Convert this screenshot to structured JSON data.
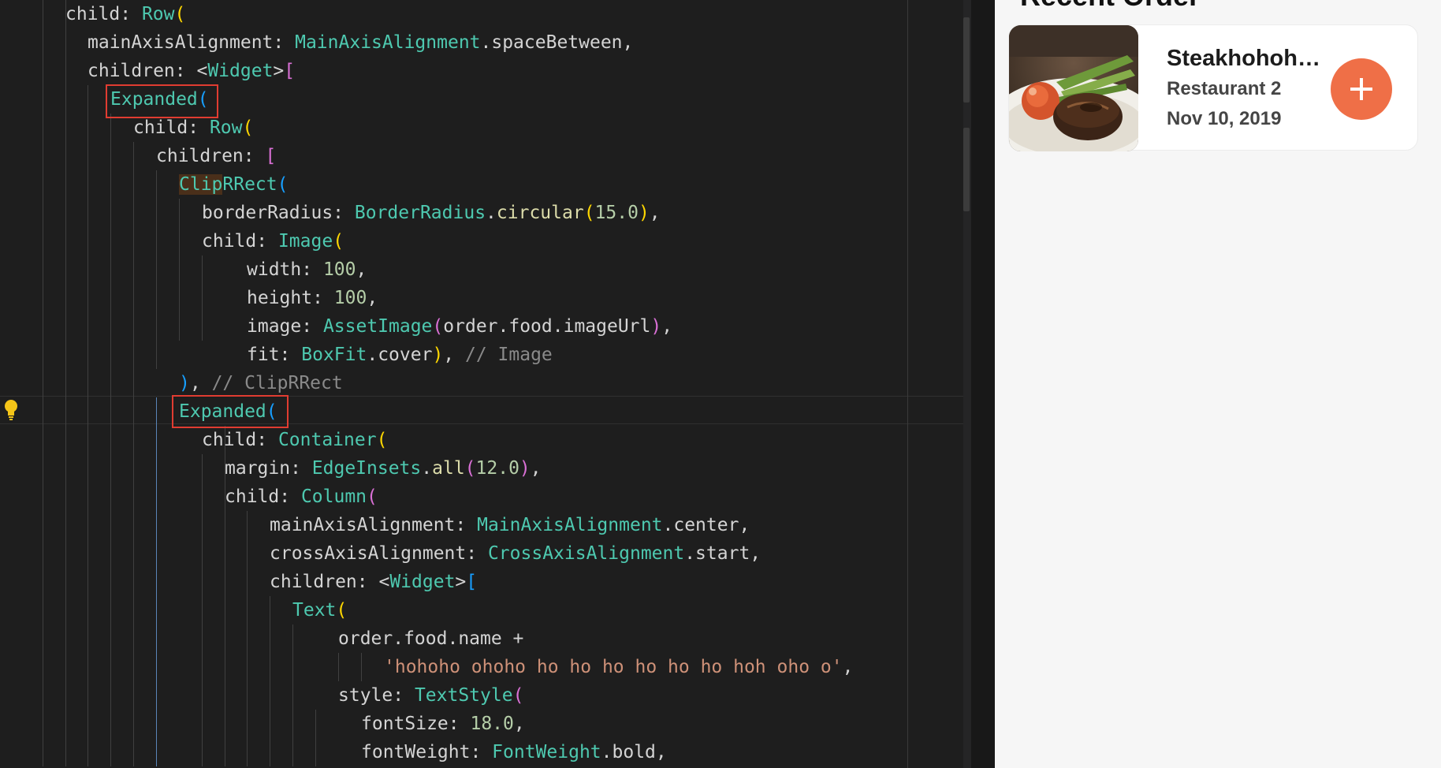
{
  "editor": {
    "lines": [
      [
        {
          "t": "child: ",
          "c": "kw"
        },
        {
          "t": "Row",
          "c": "cls"
        },
        {
          "t": "(",
          "c": "p1"
        }
      ],
      [
        {
          "t": "mainAxisAlignment: ",
          "c": "kw"
        },
        {
          "t": "MainAxisAlignment",
          "c": "cls"
        },
        {
          "t": ".spaceBetween,",
          "c": "kw"
        }
      ],
      [
        {
          "t": "children: <",
          "c": "kw"
        },
        {
          "t": "Widget",
          "c": "cls"
        },
        {
          "t": ">",
          "c": "kw"
        },
        {
          "t": "[",
          "c": "p2"
        }
      ],
      [
        {
          "t": "Expanded",
          "c": "cls"
        },
        {
          "t": "(",
          "c": "p3"
        }
      ],
      [
        {
          "t": "child: ",
          "c": "kw"
        },
        {
          "t": "Row",
          "c": "cls"
        },
        {
          "t": "(",
          "c": "p1"
        }
      ],
      [
        {
          "t": "children: ",
          "c": "kw"
        },
        {
          "t": "[",
          "c": "p2"
        }
      ],
      [
        {
          "t": "Clip",
          "c": "cls",
          "hl": true
        },
        {
          "t": "RRect",
          "c": "cls"
        },
        {
          "t": "(",
          "c": "p3"
        }
      ],
      [
        {
          "t": "borderRadius: ",
          "c": "kw"
        },
        {
          "t": "BorderRadius",
          "c": "cls"
        },
        {
          "t": ".",
          "c": "kw"
        },
        {
          "t": "circular",
          "c": "fn"
        },
        {
          "t": "(",
          "c": "p1"
        },
        {
          "t": "15.0",
          "c": "num"
        },
        {
          "t": ")",
          "c": "p1"
        },
        {
          "t": ",",
          "c": "kw"
        }
      ],
      [
        {
          "t": "child: ",
          "c": "kw"
        },
        {
          "t": "Image",
          "c": "cls"
        },
        {
          "t": "(",
          "c": "p1"
        }
      ],
      [
        {
          "t": "width: ",
          "c": "kw"
        },
        {
          "t": "100",
          "c": "num"
        },
        {
          "t": ",",
          "c": "kw"
        }
      ],
      [
        {
          "t": "height: ",
          "c": "kw"
        },
        {
          "t": "100",
          "c": "num"
        },
        {
          "t": ",",
          "c": "kw"
        }
      ],
      [
        {
          "t": "image: ",
          "c": "kw"
        },
        {
          "t": "AssetImage",
          "c": "cls"
        },
        {
          "t": "(",
          "c": "p2"
        },
        {
          "t": "order.food.imageUrl",
          "c": "kw"
        },
        {
          "t": ")",
          "c": "p2"
        },
        {
          "t": ",",
          "c": "kw"
        }
      ],
      [
        {
          "t": "fit: ",
          "c": "kw"
        },
        {
          "t": "BoxFit",
          "c": "cls"
        },
        {
          "t": ".cover",
          "c": "kw"
        },
        {
          "t": ")",
          "c": "p1"
        },
        {
          "t": ", ",
          "c": "kw"
        },
        {
          "t": "// Image",
          "c": "cmt"
        }
      ],
      [
        {
          "t": ")",
          "c": "p3"
        },
        {
          "t": ", ",
          "c": "kw"
        },
        {
          "t": "// ClipRRect",
          "c": "cmt"
        }
      ],
      [
        {
          "t": "Expanded",
          "c": "cls"
        },
        {
          "t": "(",
          "c": "p3"
        }
      ],
      [
        {
          "t": "child: ",
          "c": "kw"
        },
        {
          "t": "Container",
          "c": "cls"
        },
        {
          "t": "(",
          "c": "p1"
        }
      ],
      [
        {
          "t": "margin: ",
          "c": "kw"
        },
        {
          "t": "EdgeInsets",
          "c": "cls"
        },
        {
          "t": ".",
          "c": "kw"
        },
        {
          "t": "all",
          "c": "fn"
        },
        {
          "t": "(",
          "c": "p2"
        },
        {
          "t": "12.0",
          "c": "num"
        },
        {
          "t": ")",
          "c": "p2"
        },
        {
          "t": ",",
          "c": "kw"
        }
      ],
      [
        {
          "t": "child: ",
          "c": "kw"
        },
        {
          "t": "Column",
          "c": "cls"
        },
        {
          "t": "(",
          "c": "p2"
        }
      ],
      [
        {
          "t": "mainAxisAlignment: ",
          "c": "kw"
        },
        {
          "t": "MainAxisAlignment",
          "c": "cls"
        },
        {
          "t": ".center,",
          "c": "kw"
        }
      ],
      [
        {
          "t": "crossAxisAlignment: ",
          "c": "kw"
        },
        {
          "t": "CrossAxisAlignment",
          "c": "cls"
        },
        {
          "t": ".start,",
          "c": "kw"
        }
      ],
      [
        {
          "t": "children: <",
          "c": "kw"
        },
        {
          "t": "Widget",
          "c": "cls"
        },
        {
          "t": ">",
          "c": "kw"
        },
        {
          "t": "[",
          "c": "p3"
        }
      ],
      [
        {
          "t": "Text",
          "c": "cls"
        },
        {
          "t": "(",
          "c": "p1"
        }
      ],
      [
        {
          "t": "order.food.name +",
          "c": "kw"
        }
      ],
      [
        {
          "t": "'hohoho ohoho ho ho ho ho ho ho hoh oho o'",
          "c": "str"
        },
        {
          "t": ",",
          "c": "kw"
        }
      ],
      [
        {
          "t": "style: ",
          "c": "kw"
        },
        {
          "t": "TextStyle",
          "c": "cls"
        },
        {
          "t": "(",
          "c": "p2"
        }
      ],
      [
        {
          "t": "fontSize: ",
          "c": "kw"
        },
        {
          "t": "18.0",
          "c": "num"
        },
        {
          "t": ",",
          "c": "kw"
        }
      ],
      [
        {
          "t": "fontWeight: ",
          "c": "kw"
        },
        {
          "t": "FontWeight",
          "c": "cls"
        },
        {
          "t": ".bold,",
          "c": "kw"
        }
      ]
    ]
  },
  "preview": {
    "section_title": "Recent Order",
    "order": {
      "name": "Steakhohohoho ohoho ho ho ho ho ho ho hoh oho o",
      "restaurant": "Restaurant 2",
      "date": "Nov 10, 2019",
      "add_icon": "plus-icon",
      "accent_color": "#ef6f47"
    }
  },
  "colors": {
    "editor_background": "#1e1e1e",
    "highlight_box": "#e03c31",
    "preview_background": "#f6f6f6"
  }
}
